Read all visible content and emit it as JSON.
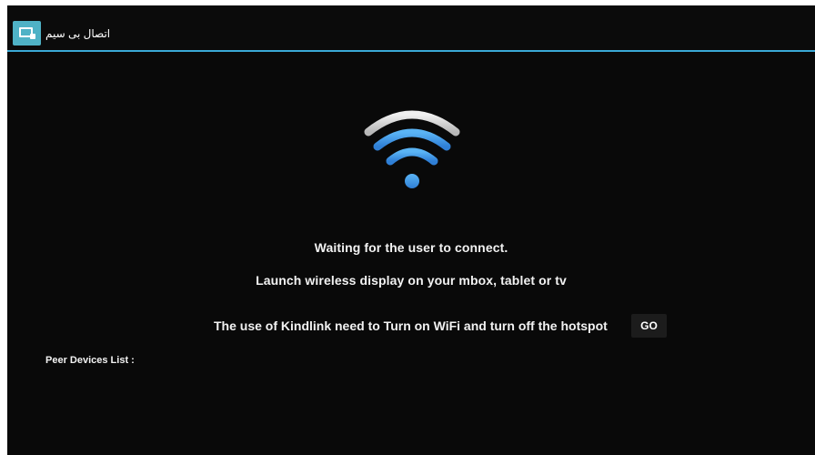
{
  "app": {
    "title": "اتصال بی سیم",
    "icon": "cast-screen-icon"
  },
  "status": {
    "waiting": "Waiting for the user to connect.",
    "instruction": "Launch wireless display on your mbox, tablet or tv",
    "hotspot_notice": "The use of Kindlink need to Turn on WiFi and turn off the hotspot",
    "go_label": "GO"
  },
  "peers": {
    "label": "Peer Devices List :",
    "items": []
  },
  "colors": {
    "accent": "#3aa8d6",
    "icon_bg": "#4fb2c6",
    "wifi_top_arc": "#d8d8d8",
    "wifi_blue": "#3b8fe0",
    "background": "#0a0a0a"
  }
}
